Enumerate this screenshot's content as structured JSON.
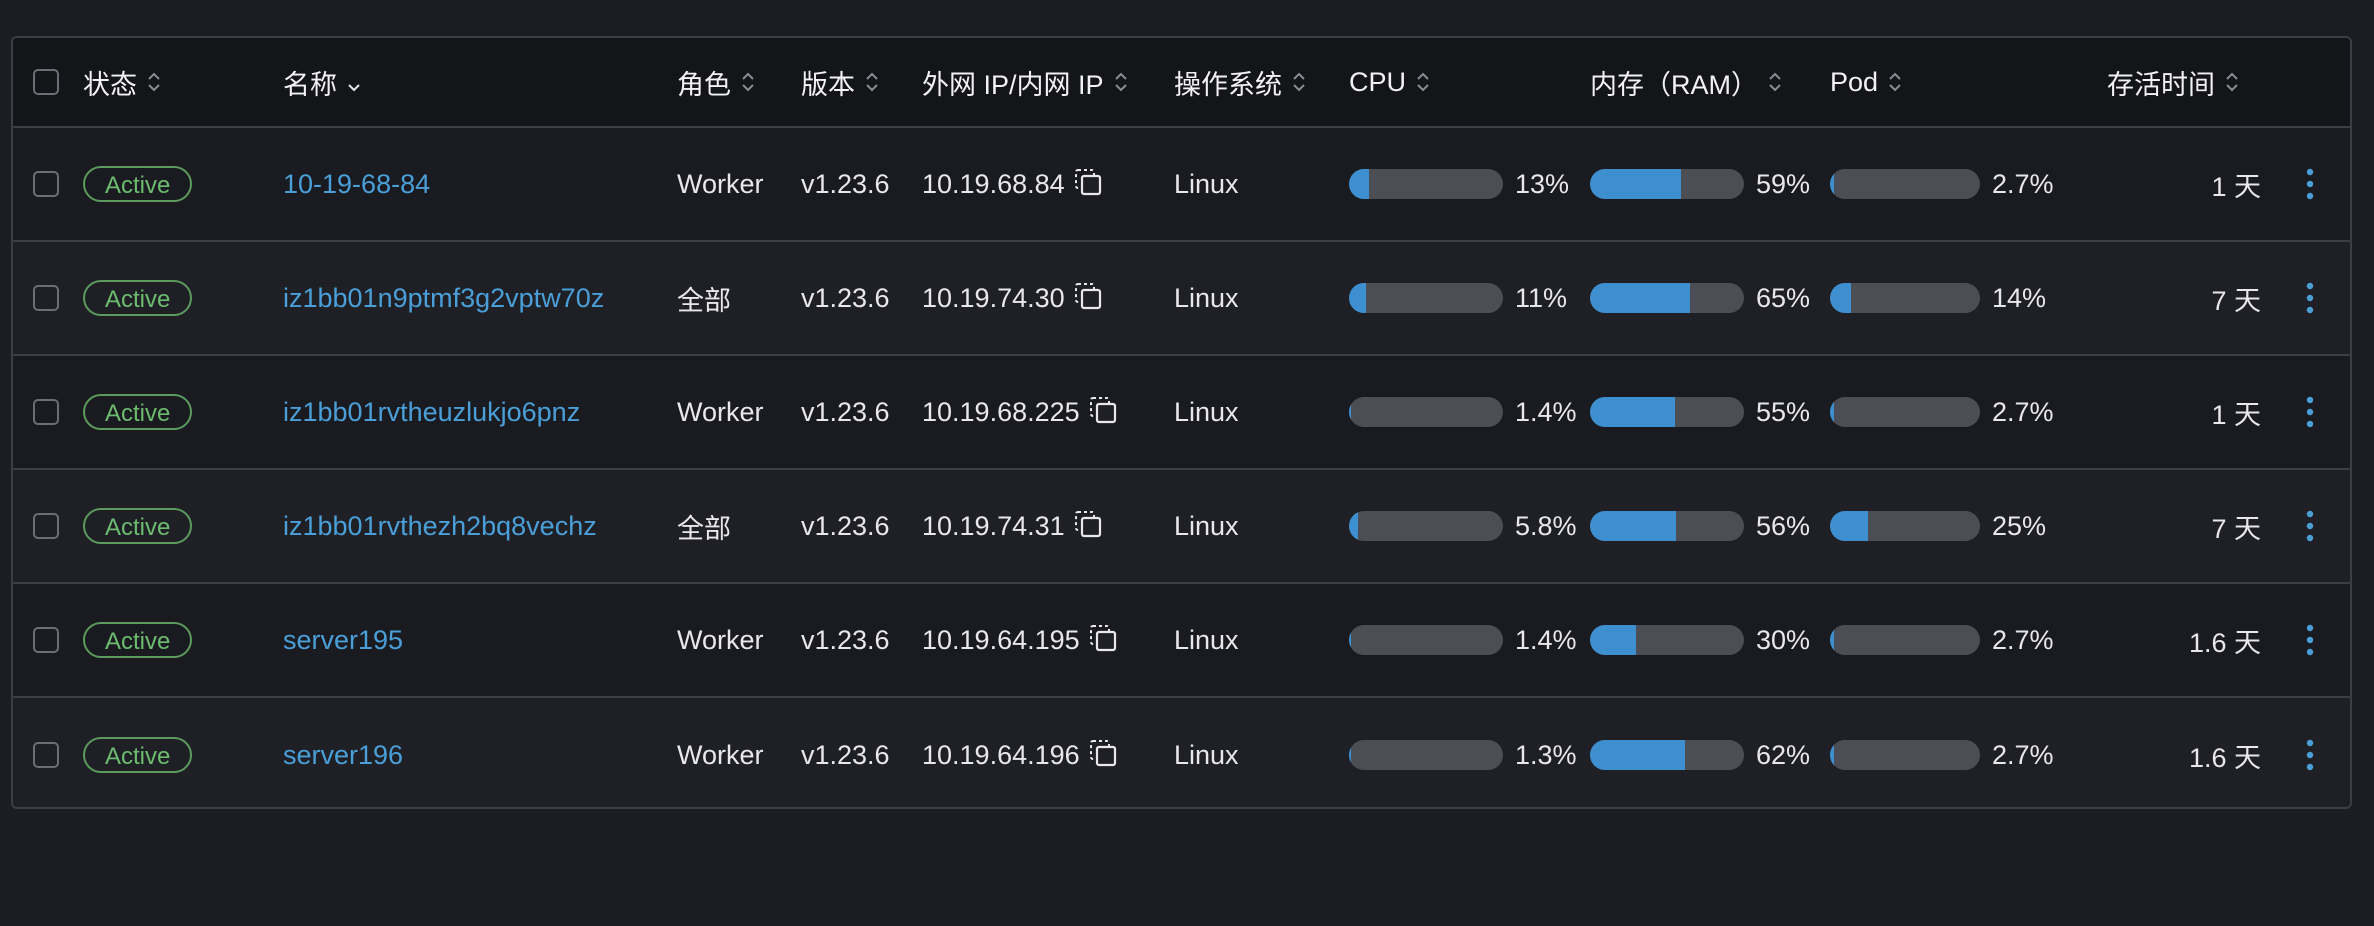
{
  "header": {
    "status": "状态",
    "name": "名称",
    "role": "角色",
    "version": "版本",
    "ip": "外网 IP/内网 IP",
    "os": "操作系统",
    "cpu": "CPU",
    "ram": "内存（RAM）",
    "pod": "Pod",
    "age": "存活时间"
  },
  "colors": {
    "accent": "#3d8fcf",
    "link": "#4a9fd8",
    "status_active": "#6dbb6f",
    "bar_track": "#4c4e56"
  },
  "rows": [
    {
      "status": "Active",
      "name": "10-19-68-84",
      "role": "Worker",
      "version": "v1.23.6",
      "ip": "10.19.68.84",
      "os": "Linux",
      "cpu": 0.13,
      "cpu_label": "13%",
      "ram": 0.59,
      "ram_label": "59%",
      "pod": 0.027,
      "pod_label": "2.7%",
      "age": "1 天"
    },
    {
      "status": "Active",
      "name": "iz1bb01n9ptmf3g2vptw70z",
      "role": "全部",
      "version": "v1.23.6",
      "ip": "10.19.74.30",
      "os": "Linux",
      "cpu": 0.11,
      "cpu_label": "11%",
      "ram": 0.65,
      "ram_label": "65%",
      "pod": 0.14,
      "pod_label": "14%",
      "age": "7 天"
    },
    {
      "status": "Active",
      "name": "iz1bb01rvtheuzlukjo6pnz",
      "role": "Worker",
      "version": "v1.23.6",
      "ip": "10.19.68.225",
      "os": "Linux",
      "cpu": 0.014,
      "cpu_label": "1.4%",
      "ram": 0.55,
      "ram_label": "55%",
      "pod": 0.027,
      "pod_label": "2.7%",
      "age": "1 天"
    },
    {
      "status": "Active",
      "name": "iz1bb01rvthezh2bq8vechz",
      "role": "全部",
      "version": "v1.23.6",
      "ip": "10.19.74.31",
      "os": "Linux",
      "cpu": 0.058,
      "cpu_label": "5.8%",
      "ram": 0.56,
      "ram_label": "56%",
      "pod": 0.25,
      "pod_label": "25%",
      "age": "7 天"
    },
    {
      "status": "Active",
      "name": "server195",
      "role": "Worker",
      "version": "v1.23.6",
      "ip": "10.19.64.195",
      "os": "Linux",
      "cpu": 0.014,
      "cpu_label": "1.4%",
      "ram": 0.3,
      "ram_label": "30%",
      "pod": 0.027,
      "pod_label": "2.7%",
      "age": "1.6 天"
    },
    {
      "status": "Active",
      "name": "server196",
      "role": "Worker",
      "version": "v1.23.6",
      "ip": "10.19.64.196",
      "os": "Linux",
      "cpu": 0.013,
      "cpu_label": "1.3%",
      "ram": 0.62,
      "ram_label": "62%",
      "pod": 0.027,
      "pod_label": "2.7%",
      "age": "1.6 天"
    }
  ]
}
